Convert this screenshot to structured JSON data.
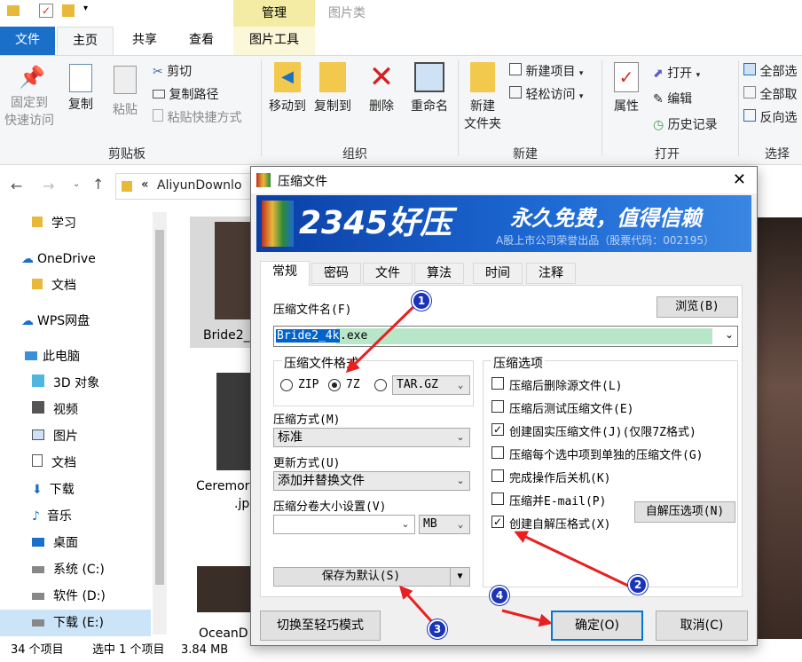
{
  "window": {
    "title": "图片类",
    "manage_tab": "管理",
    "ribbon_tabs": [
      "文件",
      "主页",
      "共享",
      "查看",
      "图片工具"
    ]
  },
  "ribbon": {
    "pin": "固定到\n快速访问",
    "copy": "复制",
    "paste": "粘贴",
    "cut": "剪切",
    "copy_path": "复制路径",
    "paste_shortcut": "粘贴快捷方式",
    "group_clipboard": "剪贴板",
    "move_to": "移动到",
    "copy_to": "复制到",
    "delete": "删除",
    "rename": "重命名",
    "group_organize": "组织",
    "new_folder": "新建\n文件夹",
    "new_item": "新建项目",
    "easy_access": "轻松访问",
    "group_new": "新建",
    "properties": "属性",
    "open": "打开",
    "edit": "编辑",
    "history": "历史记录",
    "group_open": "打开",
    "select_all": "全部选",
    "select_none": "全部取",
    "invert": "反向选",
    "group_select": "选择"
  },
  "address": {
    "path": "AliyunDownlo"
  },
  "nav": {
    "items": [
      "学习",
      "OneDrive",
      "文档",
      "WPS网盘",
      "此电脑",
      "3D 对象",
      "视频",
      "图片",
      "文档",
      "下载",
      "音乐",
      "桌面",
      "系统 (C:)",
      "软件 (D:)",
      "下载 (E:)"
    ]
  },
  "files": {
    "item1": "Bride2_",
    "item2": "Ceremor",
    "item2b": ".jp",
    "item3": "OceanD"
  },
  "status": {
    "count": "34 个项目",
    "selected": "选中 1 个项目",
    "size": "3.84 MB"
  },
  "dialog": {
    "title": "压缩文件",
    "banner_brand": "2345好压",
    "banner_slogan": "永久免费，值得信赖",
    "banner_sub": "A股上市公司荣誉出品（股票代码：002195）",
    "tabs": [
      "常规",
      "密码",
      "文件",
      "算法",
      "时间",
      "注释"
    ],
    "archive_name_label": "压缩文件名(F)",
    "browse": "浏览(B)",
    "archive_name_selected": "Bride2_4k",
    "archive_name_rest": ".exe",
    "format_label": "压缩文件格式",
    "format_zip": "ZIP",
    "format_7z": "7Z",
    "format_tar": "TAR.GZ",
    "method_label": "压缩方式(M)",
    "method_value": "标准",
    "update_label": "更新方式(U)",
    "update_value": "添加并替换文件",
    "split_label": "压缩分卷大小设置(V)",
    "split_value": "",
    "split_unit": "MB",
    "save_default": "保存为默认(S)",
    "options_label": "压缩选项",
    "options": [
      {
        "label": "压缩后删除源文件(L)",
        "checked": false
      },
      {
        "label": "压缩后测试压缩文件(E)",
        "checked": false
      },
      {
        "label": "创建固实压缩文件(J)(仅限7Z格式)",
        "checked": true
      },
      {
        "label": "压缩每个选中项到单独的压缩文件(G)",
        "checked": false
      },
      {
        "label": "完成操作后关机(K)",
        "checked": false
      },
      {
        "label": "压缩并E-mail(P)",
        "checked": false
      },
      {
        "label": "创建自解压格式(X)",
        "checked": true
      }
    ],
    "sfx_options": "自解压选项(N)",
    "easy_mode": "切换至轻巧模式",
    "ok": "确定(O)",
    "cancel": "取消(C)"
  },
  "markers": [
    "1",
    "2",
    "3",
    "4"
  ]
}
